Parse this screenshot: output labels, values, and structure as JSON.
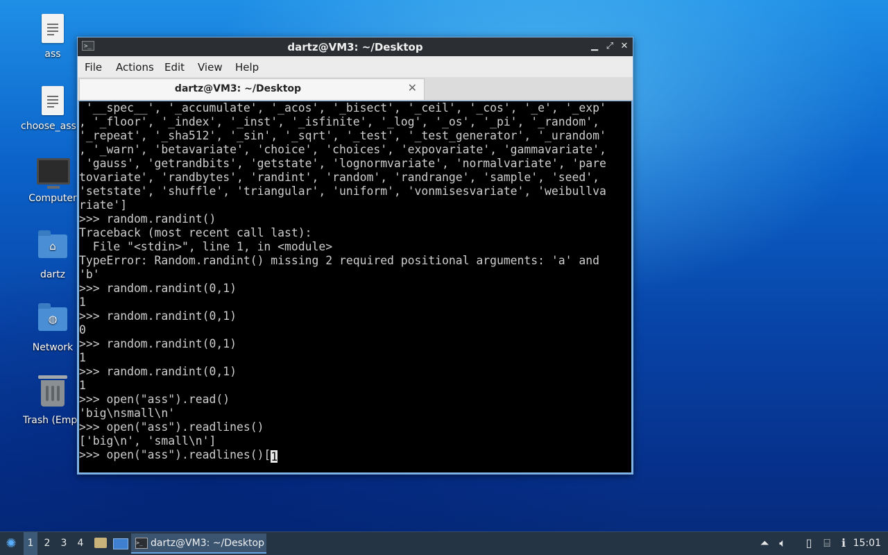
{
  "desktop": {
    "icons": [
      {
        "label": "ass",
        "icon": "text-file-icon"
      },
      {
        "label": "choose_ass.py",
        "icon": "text-file-icon"
      },
      {
        "label": "Computer",
        "icon": "computer-icon"
      },
      {
        "label": "dartz",
        "icon": "home-folder-icon"
      },
      {
        "label": "Network",
        "icon": "network-folder-icon"
      },
      {
        "label": "Trash (Empty)",
        "icon": "trash-icon"
      }
    ]
  },
  "window": {
    "title": "dartz@VM3: ~/Desktop",
    "menu": [
      "File",
      "Actions",
      "Edit",
      "View",
      "Help"
    ],
    "tab_title": "dartz@VM3: ~/Desktop",
    "terminal_lines": [
      " '__spec__', '_accumulate', '_acos', '_bisect', '_ceil', '_cos', '_e', '_exp'",
      ", '_floor', '_index', '_inst', '_isfinite', '_log', '_os', '_pi', '_random',",
      "'_repeat', '_sha512', '_sin', '_sqrt', '_test', '_test_generator', '_urandom'",
      ", '_warn', 'betavariate', 'choice', 'choices', 'expovariate', 'gammavariate',",
      " 'gauss', 'getrandbits', 'getstate', 'lognormvariate', 'normalvariate', 'pare",
      "tovariate', 'randbytes', 'randint', 'random', 'randrange', 'sample', 'seed',",
      "'setstate', 'shuffle', 'triangular', 'uniform', 'vonmisesvariate', 'weibullva",
      "riate']",
      ">>> random.randint()",
      "Traceback (most recent call last):",
      "  File \"<stdin>\", line 1, in <module>",
      "TypeError: Random.randint() missing 2 required positional arguments: 'a' and",
      "'b'",
      ">>> random.randint(0,1)",
      "1",
      ">>> random.randint(0,1)",
      "0",
      ">>> random.randint(0,1)",
      "1",
      ">>> random.randint(0,1)",
      "1",
      ">>> open(\"ass\").read()",
      "'big\\nsmall\\n'",
      ">>> open(\"ass\").readlines()",
      "['big\\n', 'small\\n']"
    ],
    "prompt_line": ">>> open(\"ass\").readlines()[",
    "cursor_char": "1"
  },
  "taskbar": {
    "workspaces": [
      "1",
      "2",
      "3",
      "4"
    ],
    "active_workspace": "1",
    "task_label": "dartz@VM3: ~/Desktop",
    "clock": "15:01"
  }
}
